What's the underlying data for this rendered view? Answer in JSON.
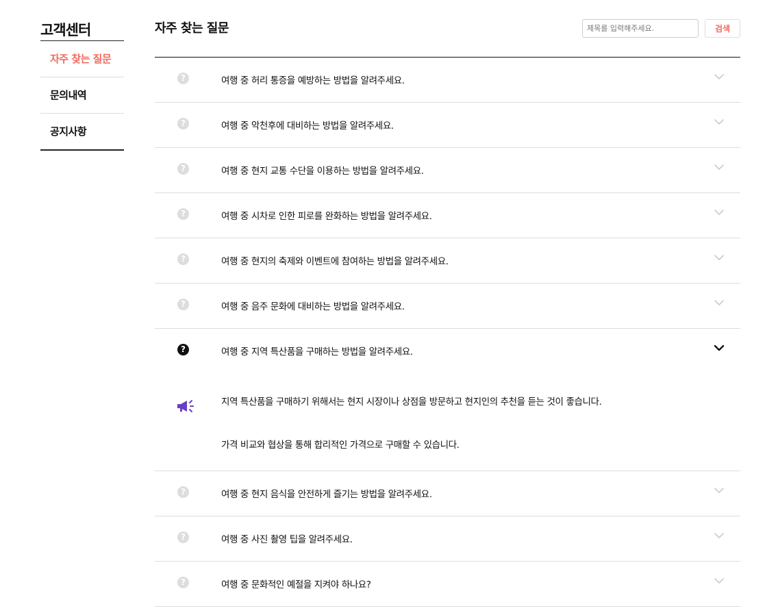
{
  "sidebar": {
    "title": "고객센터",
    "items": [
      {
        "label": "자주 찾는 질문"
      },
      {
        "label": "문의내역"
      },
      {
        "label": "공지사항"
      }
    ]
  },
  "header": {
    "title": "자주 찾는 질문",
    "search_placeholder": "제목를 입력해주세요.",
    "search_button": "검색"
  },
  "faq": [
    {
      "q": "여행 중 허리 통증을 예방하는 방법을 알려주세요."
    },
    {
      "q": "여행 중 악천후에 대비하는 방법을 알려주세요."
    },
    {
      "q": "여행 중 현지 교통 수단을 이용하는 방법을 알려주세요."
    },
    {
      "q": "여행 중 시차로 인한 피로를 완화하는 방법을 알려주세요."
    },
    {
      "q": "여행 중 현지의 축제와 이벤트에 참여하는 방법을 알려주세요."
    },
    {
      "q": "여행 중 음주 문화에 대비하는 방법을 알려주세요."
    },
    {
      "q": "여행 중 지역 특산품을 구매하는 방법을 알려주세요.",
      "open": true,
      "answer": [
        "지역 특산품을 구매하기 위해서는 현지 시장이나 상점을 방문하고 현지인의 추천을 듣는 것이 좋습니다.",
        "가격 비교와 협상을 통해 합리적인 가격으로 구매할 수 있습니다."
      ]
    },
    {
      "q": "여행 중 현지 음식을 안전하게 즐기는 방법을 알려주세요."
    },
    {
      "q": "여행 중 사진 촬영 팁을 알려주세요."
    },
    {
      "q": "여행 중 문화적인 예절을 지켜야 하나요?"
    }
  ],
  "icons": {
    "question": "question-circle-icon",
    "chevron": "chevron-down-icon",
    "answer": "megaphone-icon"
  },
  "colors": {
    "accent": "#f06a5d",
    "answer_icon": "#6b3fc4",
    "inactive_icon": "#dddddd"
  }
}
